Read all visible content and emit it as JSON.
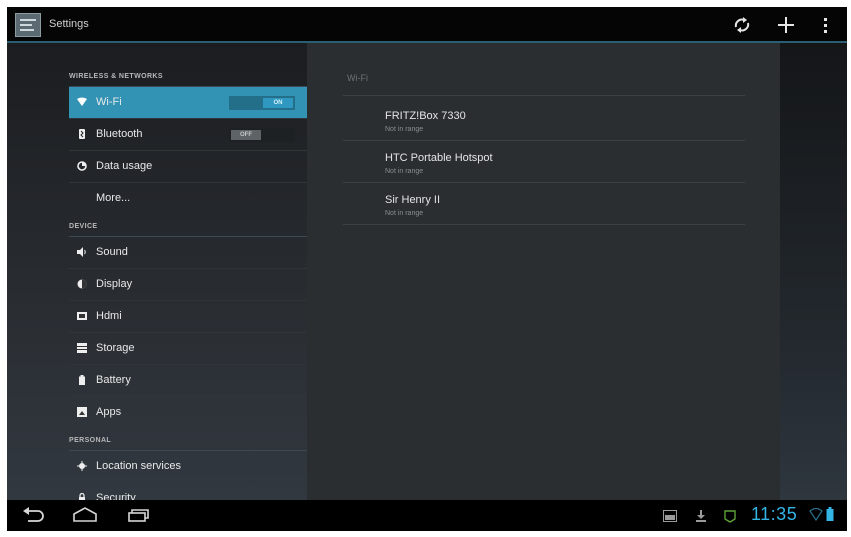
{
  "app": {
    "title": "Settings"
  },
  "actionbar": {
    "icons": [
      "wifi-scan-icon",
      "add-icon",
      "overflow-menu-icon"
    ]
  },
  "sections": [
    {
      "header": "WIRELESS & NETWORKS",
      "items": [
        {
          "label": "Wi-Fi",
          "icon": "wifi-icon",
          "selected": true,
          "toggle": "ON"
        },
        {
          "label": "Bluetooth",
          "icon": "bluetooth-icon",
          "toggle": "OFF"
        },
        {
          "label": "Data usage",
          "icon": "data-usage-icon"
        },
        {
          "label": "More...",
          "icon": ""
        }
      ]
    },
    {
      "header": "DEVICE",
      "items": [
        {
          "label": "Sound",
          "icon": "speaker-icon"
        },
        {
          "label": "Display",
          "icon": "display-icon"
        },
        {
          "label": "Hdmi",
          "icon": "hdmi-icon"
        },
        {
          "label": "Storage",
          "icon": "storage-icon"
        },
        {
          "label": "Battery",
          "icon": "battery-icon"
        },
        {
          "label": "Apps",
          "icon": "apps-icon"
        }
      ]
    },
    {
      "header": "PERSONAL",
      "items": [
        {
          "label": "Location services",
          "icon": "location-icon"
        },
        {
          "label": "Security",
          "icon": "lock-icon"
        }
      ]
    }
  ],
  "wifi_panel": {
    "header": "Wi-Fi",
    "networks": [
      {
        "name": "FRITZ!Box 7330",
        "status": "Not in range"
      },
      {
        "name": "HTC Portable Hotspot",
        "status": "Not in range"
      },
      {
        "name": "Sir Henry II",
        "status": "Not in range"
      }
    ]
  },
  "navbar": {
    "buttons": [
      "back-icon",
      "home-icon",
      "recent-apps-icon"
    ],
    "status_icons": [
      "screenshot-icon",
      "download-icon",
      "android-icon"
    ],
    "clock": "11:35",
    "accent": "#33b5e5"
  }
}
